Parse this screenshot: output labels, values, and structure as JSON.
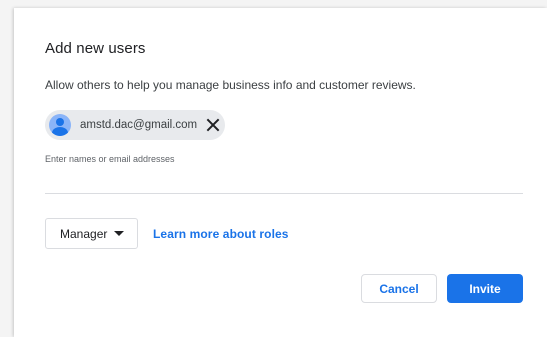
{
  "dialog": {
    "title": "Add new users",
    "subtitle": "Allow others to help you manage business info and customer reviews."
  },
  "invitee": {
    "email": "amstd.dac@gmail.com"
  },
  "input": {
    "hint": "Enter names or email addresses"
  },
  "role": {
    "selected": "Manager",
    "learn_more": "Learn more about roles"
  },
  "actions": {
    "cancel": "Cancel",
    "invite": "Invite"
  },
  "colors": {
    "accent": "#1a73e8",
    "chip_bg": "#e8eaed"
  }
}
